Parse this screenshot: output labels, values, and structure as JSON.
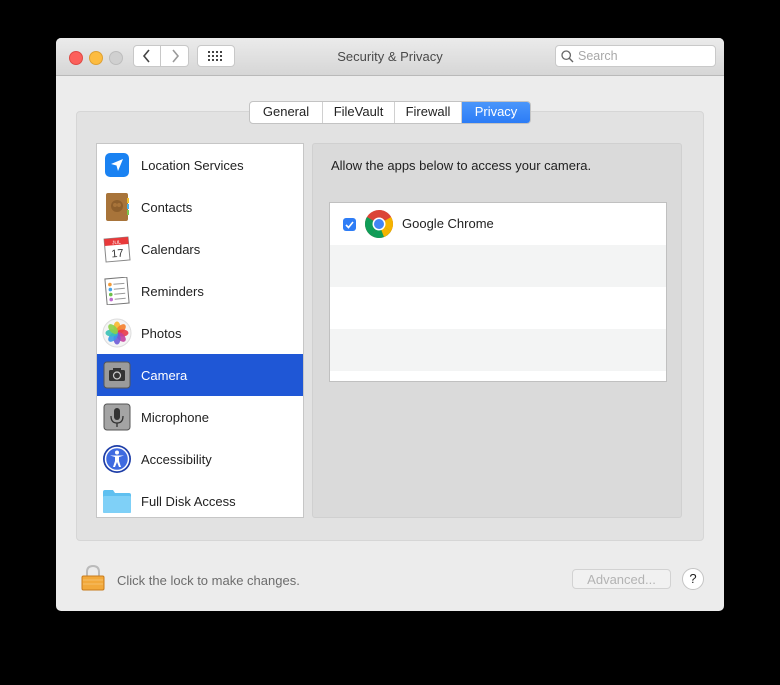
{
  "window": {
    "title": "Security & Privacy",
    "search_placeholder": "Search",
    "search_value": ""
  },
  "tabs": [
    {
      "label": "General",
      "active": false
    },
    {
      "label": "FileVault",
      "active": false
    },
    {
      "label": "Firewall",
      "active": false
    },
    {
      "label": "Privacy",
      "active": true
    }
  ],
  "sidebar": {
    "items": [
      {
        "label": "Location Services",
        "icon": "location-arrow-icon",
        "selected": false
      },
      {
        "label": "Contacts",
        "icon": "contacts-book-icon",
        "selected": false
      },
      {
        "label": "Calendars",
        "icon": "calendar-icon",
        "selected": false,
        "icon_text_month": "JUL",
        "icon_text_day": "17"
      },
      {
        "label": "Reminders",
        "icon": "reminders-list-icon",
        "selected": false
      },
      {
        "label": "Photos",
        "icon": "photos-flower-icon",
        "selected": false
      },
      {
        "label": "Camera",
        "icon": "camera-icon",
        "selected": true
      },
      {
        "label": "Microphone",
        "icon": "microphone-icon",
        "selected": false
      },
      {
        "label": "Accessibility",
        "icon": "accessibility-icon",
        "selected": false
      },
      {
        "label": "Full Disk Access",
        "icon": "folder-icon",
        "selected": false
      }
    ]
  },
  "main": {
    "description": "Allow the apps below to access your camera.",
    "apps": [
      {
        "name": "Google Chrome",
        "checked": true,
        "icon": "chrome-icon"
      }
    ]
  },
  "footer": {
    "lock_text": "Click the lock to make changes.",
    "advanced_label": "Advanced...",
    "help_label": "?"
  },
  "colors": {
    "accent": "#2c7cf6",
    "selection": "#1f57d6",
    "close": "#fc605b",
    "minimize": "#fdbc40"
  }
}
